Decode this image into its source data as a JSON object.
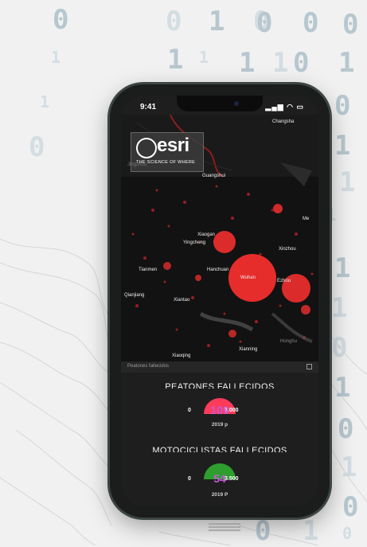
{
  "background": {
    "digits": [
      "0",
      "0",
      "1",
      "0",
      "0",
      "0",
      "0",
      "1",
      "1",
      "1",
      "1",
      "1",
      "0",
      "1",
      "0",
      "1",
      "1",
      "1",
      "0",
      "1",
      "1",
      "1",
      "0",
      "1",
      "0",
      "1",
      "0",
      "0",
      "1",
      "0"
    ]
  },
  "status_bar": {
    "time": "9:41",
    "icons": "▂▄▆ ◠ ▭"
  },
  "logo": {
    "brand": "esri",
    "tagline": "THE SCIENCE OF WHERE"
  },
  "map": {
    "caption": "Peatones fallecidos",
    "cities": [
      "Changsha",
      "Guangshui",
      "Xiaogan",
      "Yingcheng",
      "Wuhan",
      "Tianmen",
      "Hanchuan",
      "Xinzhou",
      "Ezhou",
      "Qianjiang",
      "Xiantao",
      "Xianning",
      "Jingzhou",
      "Xiaoqing",
      "Me",
      "Honghu"
    ],
    "accent_color": "#ff2a2a"
  },
  "sections": [
    {
      "title": "PEATONES FALLECIDOS",
      "min": "0",
      "max": "3.000",
      "value": "109",
      "subtitle": "2019 p",
      "gauge_color": "#ff3b5b",
      "fraction": 0.036
    },
    {
      "title": "MOTOCICLISTAS FALLECIDOS",
      "min": "0",
      "max": "3.500",
      "value": "54",
      "subtitle": "2019 P",
      "gauge_color": "#2e9e2e",
      "fraction": 0.015
    }
  ]
}
